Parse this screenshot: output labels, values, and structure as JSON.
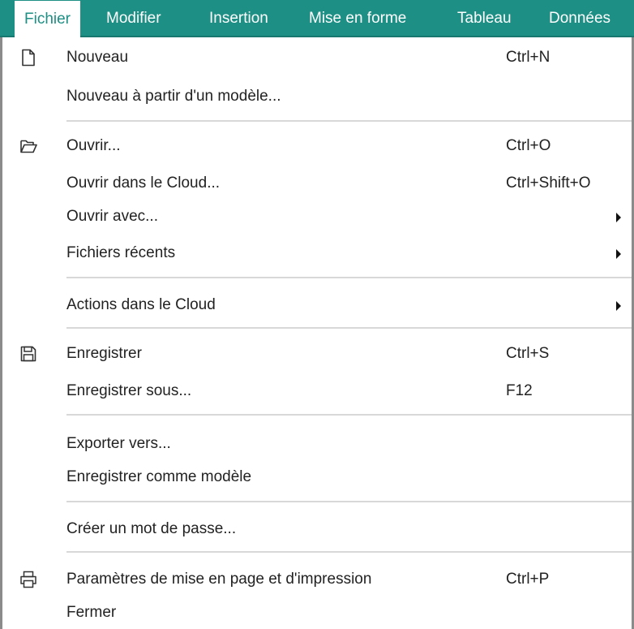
{
  "menubar": {
    "tabs": [
      {
        "label": "Fichier"
      },
      {
        "label": "Modifier"
      },
      {
        "label": "Insertion"
      },
      {
        "label": "Mise en forme"
      },
      {
        "label": "Tableau"
      },
      {
        "label": "Données"
      }
    ],
    "active_tab": "Fichier"
  },
  "colors": {
    "accent": "#1d8f84",
    "separator": "#d8d8d8",
    "border": "#8b8b8b"
  },
  "menu": {
    "items": [
      {
        "label": "Nouveau",
        "shortcut": "Ctrl+N",
        "icon": "new-document-icon"
      },
      {
        "label": "Nouveau à partir d'un modèle..."
      },
      {
        "label": "Ouvrir...",
        "shortcut": "Ctrl+O",
        "icon": "open-folder-icon"
      },
      {
        "label": "Ouvrir dans le Cloud...",
        "shortcut": "Ctrl+Shift+O"
      },
      {
        "label": "Ouvrir avec...",
        "submenu": true
      },
      {
        "label": "Fichiers récents",
        "submenu": true
      },
      {
        "label": "Actions dans le Cloud",
        "submenu": true
      },
      {
        "label": "Enregistrer",
        "shortcut": "Ctrl+S",
        "icon": "save-disk-icon"
      },
      {
        "label": "Enregistrer sous...",
        "shortcut": "F12"
      },
      {
        "label": "Exporter vers..."
      },
      {
        "label": "Enregistrer comme modèle"
      },
      {
        "label": "Créer un mot de passe..."
      },
      {
        "label": "Paramètres de mise en page et d'impression",
        "shortcut": "Ctrl+P",
        "icon": "printer-icon"
      },
      {
        "label": "Fermer"
      }
    ]
  }
}
